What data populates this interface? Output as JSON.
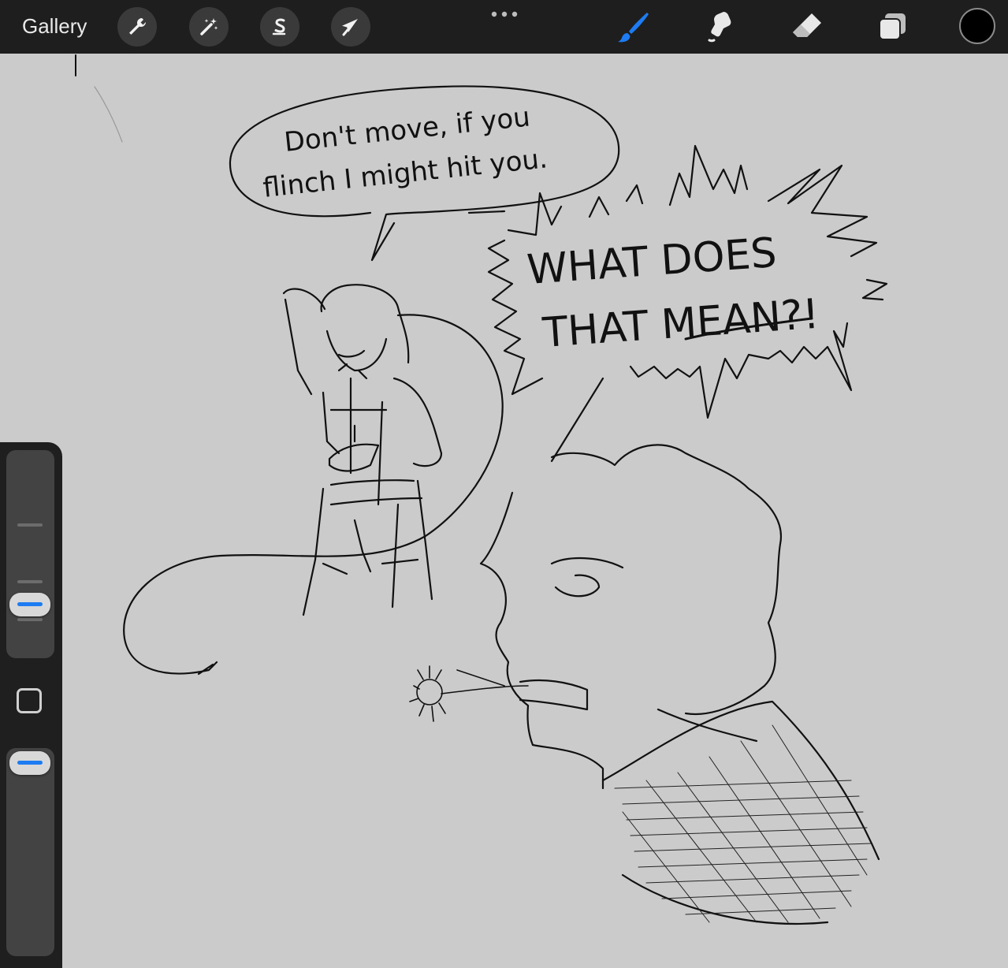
{
  "toolbar": {
    "gallery_label": "Gallery",
    "left_tools": [
      {
        "name": "actions",
        "icon": "wrench-icon"
      },
      {
        "name": "adjustments",
        "icon": "magic-wand-icon"
      },
      {
        "name": "selection",
        "icon": "selection-s-icon"
      },
      {
        "name": "transform",
        "icon": "arrow-cursor-icon"
      }
    ],
    "right_tools": [
      {
        "name": "brush",
        "icon": "brush-icon",
        "active": true
      },
      {
        "name": "smudge",
        "icon": "smudge-finger-icon",
        "active": false
      },
      {
        "name": "eraser",
        "icon": "eraser-icon",
        "active": false
      },
      {
        "name": "layers",
        "icon": "layers-icon",
        "active": false
      }
    ],
    "current_color": "#000000",
    "accent_color": "#1d7cf2"
  },
  "drawing": {
    "speech_bubble_text_line1": "Don't move, if you",
    "speech_bubble_text_line2": "flinch I might hit you.",
    "shout_text_line1": "WHAT DOES",
    "shout_text_line2": "THAT MEAN?!"
  },
  "sidebar": {
    "brush_size_icon": "brush-size-slider",
    "opacity_icon": "opacity-slider",
    "modify_icon": "modify-square-icon"
  }
}
